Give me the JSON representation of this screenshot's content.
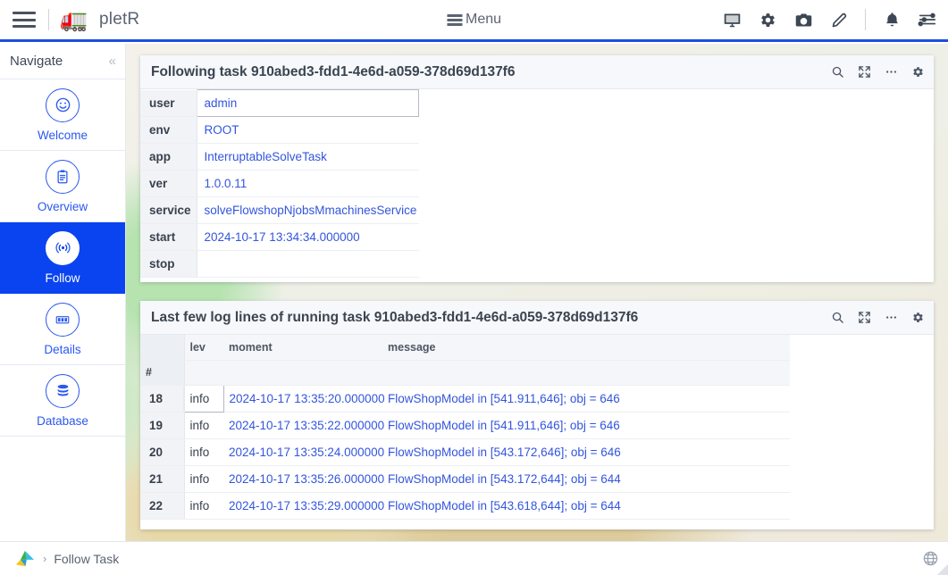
{
  "header": {
    "brand": "pletR",
    "menu_label": "Menu",
    "hamburger_icon": "hamburger-menu-icon",
    "logo_icon": "forklift-logo-icon",
    "icons": [
      {
        "name": "monitor-icon",
        "label": "monitor"
      },
      {
        "name": "gear-icon",
        "label": "settings"
      },
      {
        "name": "camera-icon",
        "label": "camera"
      },
      {
        "name": "pencil-icon",
        "label": "edit"
      },
      {
        "name": "bell-icon",
        "label": "notifications"
      },
      {
        "name": "sliders-icon",
        "label": "preferences"
      }
    ]
  },
  "sidebar": {
    "title": "Navigate",
    "collapse_icon": "«",
    "items": [
      {
        "label": "Welcome",
        "icon": "smiley-face-icon",
        "active": false
      },
      {
        "label": "Overview",
        "icon": "clipboard-icon",
        "active": false
      },
      {
        "label": "Follow",
        "icon": "broadcast-signal-icon",
        "active": true
      },
      {
        "label": "Details",
        "icon": "grid-blocks-icon",
        "active": false
      },
      {
        "label": "Database",
        "icon": "database-stack-icon",
        "active": false
      }
    ]
  },
  "task_panel": {
    "title": "Following task 910abed3-fdd1-4e6d-a059-378d69d137f6",
    "actions": [
      {
        "name": "search-icon",
        "label": "search"
      },
      {
        "name": "expand-icon",
        "label": "fullscreen"
      },
      {
        "name": "ellipsis-icon",
        "label": "more"
      },
      {
        "name": "gear-icon",
        "label": "settings"
      }
    ],
    "rows": [
      {
        "key": "user",
        "value": "admin",
        "selected": true
      },
      {
        "key": "env",
        "value": "ROOT",
        "selected": false
      },
      {
        "key": "app",
        "value": "InterruptableSolveTask",
        "selected": false
      },
      {
        "key": "ver",
        "value": "1.0.0.11",
        "selected": false
      },
      {
        "key": "service",
        "value": "solveFlowshopNjobsMmachinesService",
        "selected": false
      },
      {
        "key": "start",
        "value": "2024-10-17 13:34:34.000000",
        "selected": false
      },
      {
        "key": "stop",
        "value": "",
        "selected": false
      }
    ]
  },
  "log_panel": {
    "title": "Last few log lines of running task 910abed3-fdd1-4e6d-a059-378d69d137f6",
    "actions": [
      {
        "name": "search-icon",
        "label": "search"
      },
      {
        "name": "expand-icon",
        "label": "fullscreen"
      },
      {
        "name": "ellipsis-icon",
        "label": "more"
      },
      {
        "name": "gear-icon",
        "label": "settings"
      }
    ],
    "columns": [
      "lev",
      "moment",
      "message"
    ],
    "num_header": "#",
    "rows": [
      {
        "num": "18",
        "lev": "info",
        "moment": "2024-10-17 13:35:20.000000",
        "message": "FlowShopModel in [541.911,646]; obj = 646",
        "selected": true
      },
      {
        "num": "19",
        "lev": "info",
        "moment": "2024-10-17 13:35:22.000000",
        "message": "FlowShopModel in [541.911,646]; obj = 646",
        "selected": false
      },
      {
        "num": "20",
        "lev": "info",
        "moment": "2024-10-17 13:35:24.000000",
        "message": "FlowShopModel in [543.172,646]; obj = 646",
        "selected": false
      },
      {
        "num": "21",
        "lev": "info",
        "moment": "2024-10-17 13:35:26.000000",
        "message": "FlowShopModel in [543.172,644]; obj = 644",
        "selected": false
      },
      {
        "num": "22",
        "lev": "info",
        "moment": "2024-10-17 13:35:29.000000",
        "message": "FlowShopModel in [543.618,644]; obj = 644",
        "selected": false
      }
    ]
  },
  "statusbar": {
    "logo_icon": "tri-color-triangle-logo-icon",
    "chevron": "›",
    "text": "Follow Task",
    "right_icon": "globe-icon"
  },
  "colors": {
    "accent": "#0a44f0",
    "link": "#3355dd",
    "topbar_underline": "#1b4fe0",
    "panel_header_bg": "#f6f8fb"
  }
}
